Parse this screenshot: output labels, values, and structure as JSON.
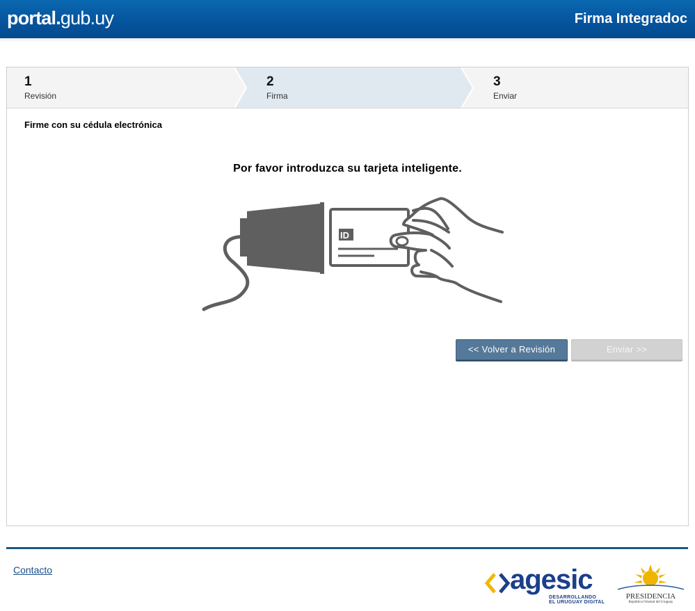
{
  "header": {
    "logo_bold": "portal.",
    "logo_light": "gub.uy",
    "app_title": "Firma Integradoc"
  },
  "steps": [
    {
      "number": "1",
      "label": "Revisión",
      "state": "done"
    },
    {
      "number": "2",
      "label": "Firma",
      "state": "active"
    },
    {
      "number": "3",
      "label": "Enviar",
      "state": "pending"
    }
  ],
  "main": {
    "instruction": "Firme con su cédula electrónica",
    "prompt": "Por favor introduzca su tarjeta inteligente.",
    "card_chip_text": "ID",
    "back_button": "<< Volver a Revisión",
    "send_button": "Enviar >>"
  },
  "footer": {
    "contact_link": "Contacto",
    "agesic_name": "agesic",
    "agesic_tag_1": "DESARROLLANDO",
    "agesic_tag_2": "EL URUGUAY DIGITAL",
    "presidencia_name": "PRESIDENCIA",
    "presidencia_sub": "República Oriental del Uruguay"
  },
  "colors": {
    "header_blue": "#0656a0",
    "active_step_bg": "#e1e9f0",
    "back_button_bg": "#557999",
    "disabled_button_bg": "#d2d2d2",
    "footer_line": "#1a5a84",
    "agesic_blue": "#1b3f8b",
    "agesic_yellow": "#f2b705",
    "sun_yellow": "#f0b400",
    "illustration_gray": "#5f5f5f"
  }
}
